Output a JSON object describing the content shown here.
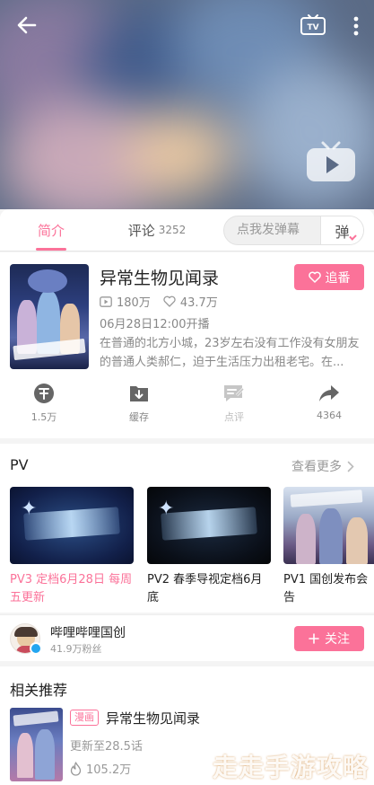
{
  "tabs": {
    "intro_label": "简介",
    "comment_label": "评论",
    "comment_count": "3252",
    "danmaku_placeholder": "点我发弹幕",
    "danmaku_toggle": "弹"
  },
  "anime": {
    "title": "异常生物见闻录",
    "follow_label": "追番",
    "plays": "180万",
    "likes": "43.7万",
    "airdate": "06月28日12:00开播",
    "description": "在普通的北方小城，23岁左右没有工作没有女朋友的普通人类郝仁，迫于生活压力出租老宅。在..."
  },
  "actions": [
    {
      "label": "1.5万",
      "icon": "coin-icon"
    },
    {
      "label": "缓存",
      "icon": "download-icon"
    },
    {
      "label": "点评",
      "icon": "review-icon"
    },
    {
      "label": "4364",
      "icon": "share-icon"
    }
  ],
  "pv": {
    "header": "PV",
    "more_label": "查看更多",
    "items": [
      {
        "caption": "PV3 定档6月28日 每周五更新",
        "active": true
      },
      {
        "caption": "PV2 春季导视定档6月底",
        "active": false
      },
      {
        "caption": "PV1 国创发布会告",
        "active": false
      }
    ]
  },
  "uploader": {
    "name": "哔哩哔哩国创",
    "fans": "41.9万粉丝",
    "follow_label": "关注"
  },
  "related": {
    "title": "相关推荐",
    "item": {
      "tag": "漫画",
      "name": "异常生物见闻录",
      "update": "更新至28.5话",
      "heat": "105.2万"
    }
  },
  "watermark": "走走手游攻略",
  "colors": {
    "accent": "#fb7299"
  }
}
